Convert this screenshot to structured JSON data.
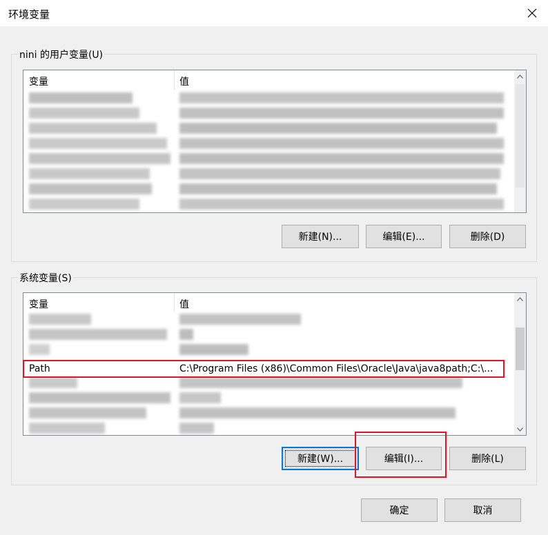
{
  "window": {
    "title": "环境变量",
    "close_glyph": "✕"
  },
  "user_vars": {
    "group_label": "nini 的用户变量(U)",
    "col_variable": "变量",
    "col_value": "值",
    "btn_new": "新建(N)...",
    "btn_edit": "编辑(E)...",
    "btn_delete": "删除(D)"
  },
  "system_vars": {
    "group_label": "系统变量(S)",
    "col_variable": "变量",
    "col_value": "值",
    "path_row": {
      "name": "Path",
      "value": "C:\\Program Files (x86)\\Common Files\\Oracle\\Java\\java8path;C:\\..."
    },
    "btn_new": "新建(W)...",
    "btn_edit": "编辑(I)...",
    "btn_delete": "删除(L)"
  },
  "footer": {
    "btn_ok": "确定",
    "btn_cancel": "取消"
  },
  "colors": {
    "annotation_red": "#e81123",
    "focus_blue": "#0078d7"
  }
}
